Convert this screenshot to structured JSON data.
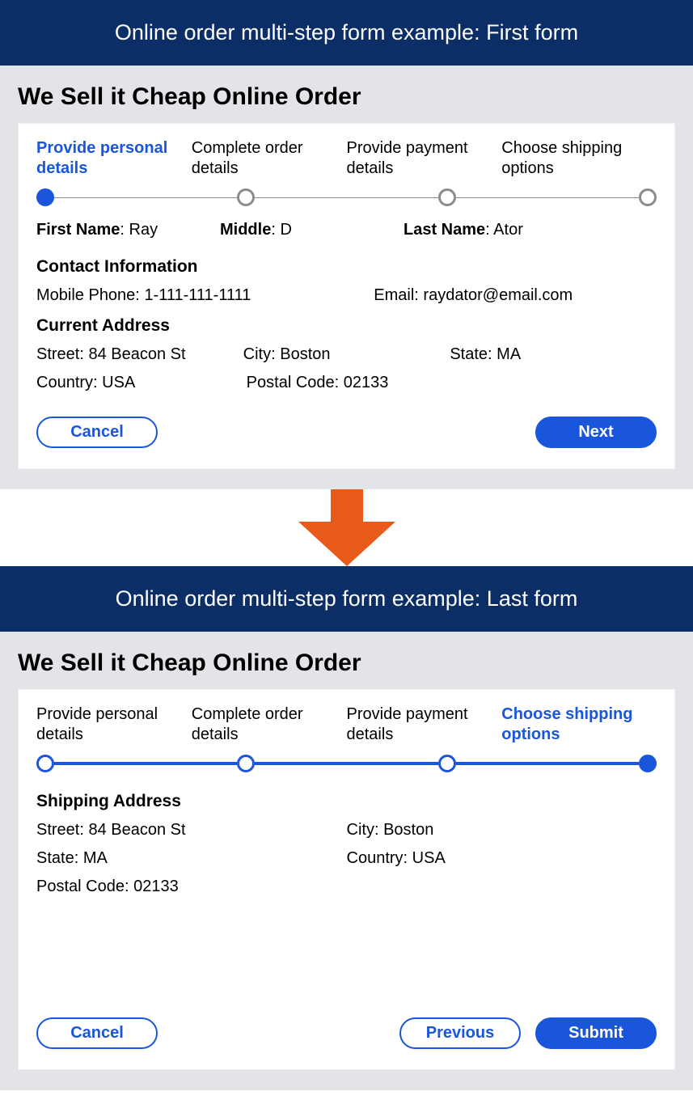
{
  "colors": {
    "brand_blue": "#1a56db",
    "banner_bg": "#0b2e66",
    "arrow": "#e85a1a"
  },
  "top": {
    "banner": "Online order multi-step form example: First form",
    "page_title": "We Sell it Cheap Online Order",
    "steps": [
      {
        "label": "Provide personal details",
        "active": true
      },
      {
        "label": "Complete order details",
        "active": false
      },
      {
        "label": "Provide payment details",
        "active": false
      },
      {
        "label": "Choose shipping options",
        "active": false
      }
    ],
    "first_name_label": "First Name",
    "first_name_value": "Ray",
    "middle_label": "Middle",
    "middle_value": "D",
    "last_name_label": "Last Name",
    "last_name_value": "Ator",
    "contact_header": "Contact Information",
    "mobile_label": "Mobile Phone:",
    "mobile_value": "1-111-111-1111",
    "email_label": "Email:",
    "email_value": "raydator@email.com",
    "address_header": "Current Address",
    "street_label": "Street:",
    "street_value": "84 Beacon St",
    "city_label": "City:",
    "city_value": "Boston",
    "state_label": "State:",
    "state_value": "MA",
    "country_label": "Country:",
    "country_value": "USA",
    "postal_label": "Postal Code:",
    "postal_value": "02133",
    "cancel_label": "Cancel",
    "next_label": "Next"
  },
  "bottom": {
    "banner": "Online order multi-step form example: Last form",
    "page_title": "We Sell it Cheap Online Order",
    "steps": [
      {
        "label": "Provide personal details",
        "active": false
      },
      {
        "label": "Complete order details",
        "active": false
      },
      {
        "label": "Provide payment details",
        "active": false
      },
      {
        "label": "Choose shipping options",
        "active": true
      }
    ],
    "shipping_header": "Shipping Address",
    "street_label": "Street:",
    "street_value": "84 Beacon St",
    "city_label": "City:",
    "city_value": "Boston",
    "state_label": "State:",
    "state_value": "MA",
    "country_label": "Country:",
    "country_value": "USA",
    "postal_label": "Postal Code:",
    "postal_value": "02133",
    "cancel_label": "Cancel",
    "previous_label": "Previous",
    "submit_label": "Submit"
  }
}
